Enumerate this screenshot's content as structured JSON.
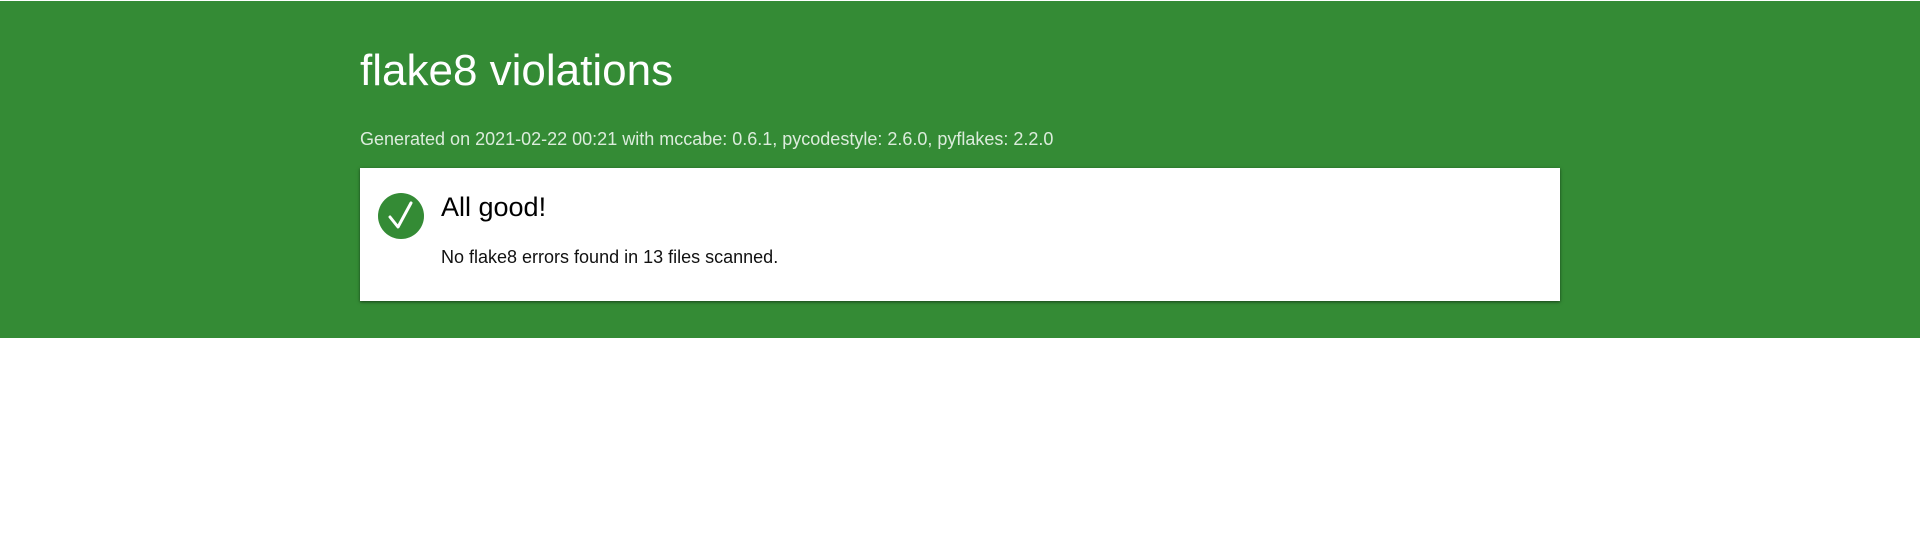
{
  "header": {
    "title": "flake8 violations",
    "generated": "Generated on 2021-02-22 00:21 with mccabe: 0.6.1, pycodestyle: 2.6.0, pyflakes: 2.2.0"
  },
  "status_card": {
    "icon": "checkmark-icon",
    "title": "All good!",
    "message": "No flake8 errors found in 13 files scanned."
  },
  "colors": {
    "banner": "#348b35",
    "card_background": "#ffffff"
  }
}
